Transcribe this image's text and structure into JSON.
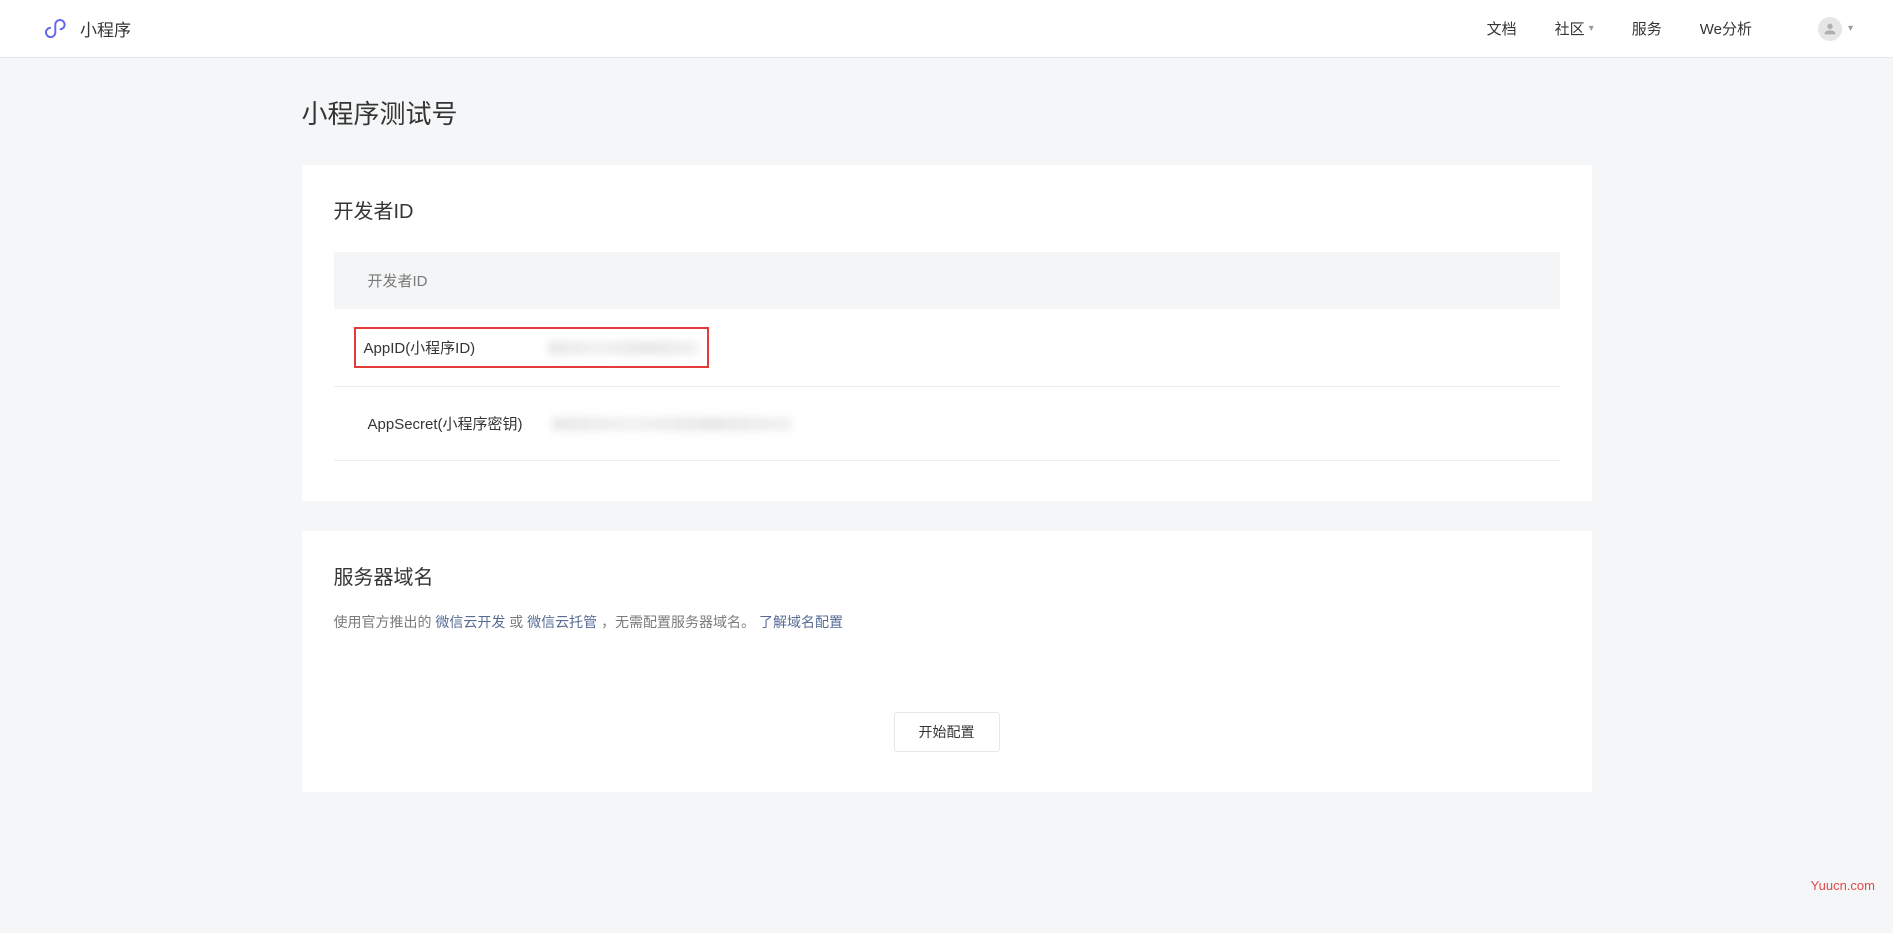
{
  "header": {
    "logo_text": "小程序",
    "nav": {
      "docs": "文档",
      "community": "社区",
      "service": "服务",
      "weanalysis": "We分析"
    }
  },
  "page": {
    "title": "小程序测试号"
  },
  "dev_card": {
    "heading": "开发者ID",
    "subheader": "开发者ID",
    "rows": {
      "appid_label": "AppID(小程序ID)",
      "appsecret_label": "AppSecret(小程序密钥)"
    }
  },
  "domain_card": {
    "heading": "服务器域名",
    "desc_prefix": "使用官方推出的 ",
    "link_cloud_dev": "微信云开发",
    "desc_or": " 或 ",
    "link_cloud_host": "微信云托管",
    "desc_mid": "，无需配置服务器域名。",
    "link_learn": "了解域名配置",
    "config_btn": "开始配置"
  },
  "watermark": "Yuucn.com"
}
